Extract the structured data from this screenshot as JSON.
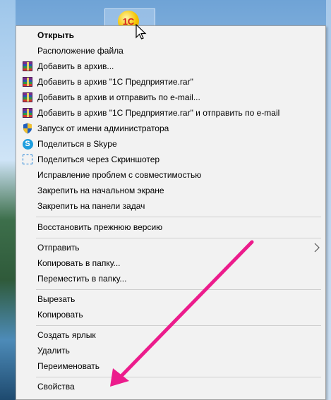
{
  "desktop": {
    "icon_text": "1С"
  },
  "menu": {
    "items": [
      {
        "label": "Открыть",
        "icon": "none",
        "bold": true
      },
      {
        "label": "Расположение файла",
        "icon": "none"
      },
      {
        "label": "Добавить в архив...",
        "icon": "winrar-icon"
      },
      {
        "label": "Добавить в архив \"1С Предприятие.rar\"",
        "icon": "winrar-icon"
      },
      {
        "label": "Добавить в архив и отправить по e-mail...",
        "icon": "winrar-icon"
      },
      {
        "label": "Добавить в архив \"1С Предприятие.rar\" и отправить по e-mail",
        "icon": "winrar-icon"
      },
      {
        "label": "Запуск от имени администратора",
        "icon": "uac-shield-icon"
      },
      {
        "label": "Поделиться в Skype",
        "icon": "skype-icon"
      },
      {
        "label": "Поделиться через Скриншотер",
        "icon": "screenshot-icon"
      },
      {
        "label": "Исправление проблем с совместимостью",
        "icon": "none"
      },
      {
        "label": "Закрепить на начальном экране",
        "icon": "none"
      },
      {
        "label": "Закрепить на панели задач",
        "icon": "none"
      },
      {
        "label": "Восстановить прежнюю версию",
        "icon": "none"
      },
      {
        "label": "Отправить",
        "icon": "none",
        "submenu": true
      },
      {
        "label": "Копировать в папку...",
        "icon": "none"
      },
      {
        "label": "Переместить в папку...",
        "icon": "none"
      },
      {
        "label": "Вырезать",
        "icon": "none"
      },
      {
        "label": "Копировать",
        "icon": "none"
      },
      {
        "label": "Создать ярлык",
        "icon": "none"
      },
      {
        "label": "Удалить",
        "icon": "none"
      },
      {
        "label": "Переименовать",
        "icon": "none"
      },
      {
        "label": "Свойства",
        "icon": "none"
      }
    ]
  },
  "colors": {
    "menu_bg": "#f2f2f2",
    "annotation_arrow": "#ec1c8c",
    "skype": "#1e9ede"
  }
}
